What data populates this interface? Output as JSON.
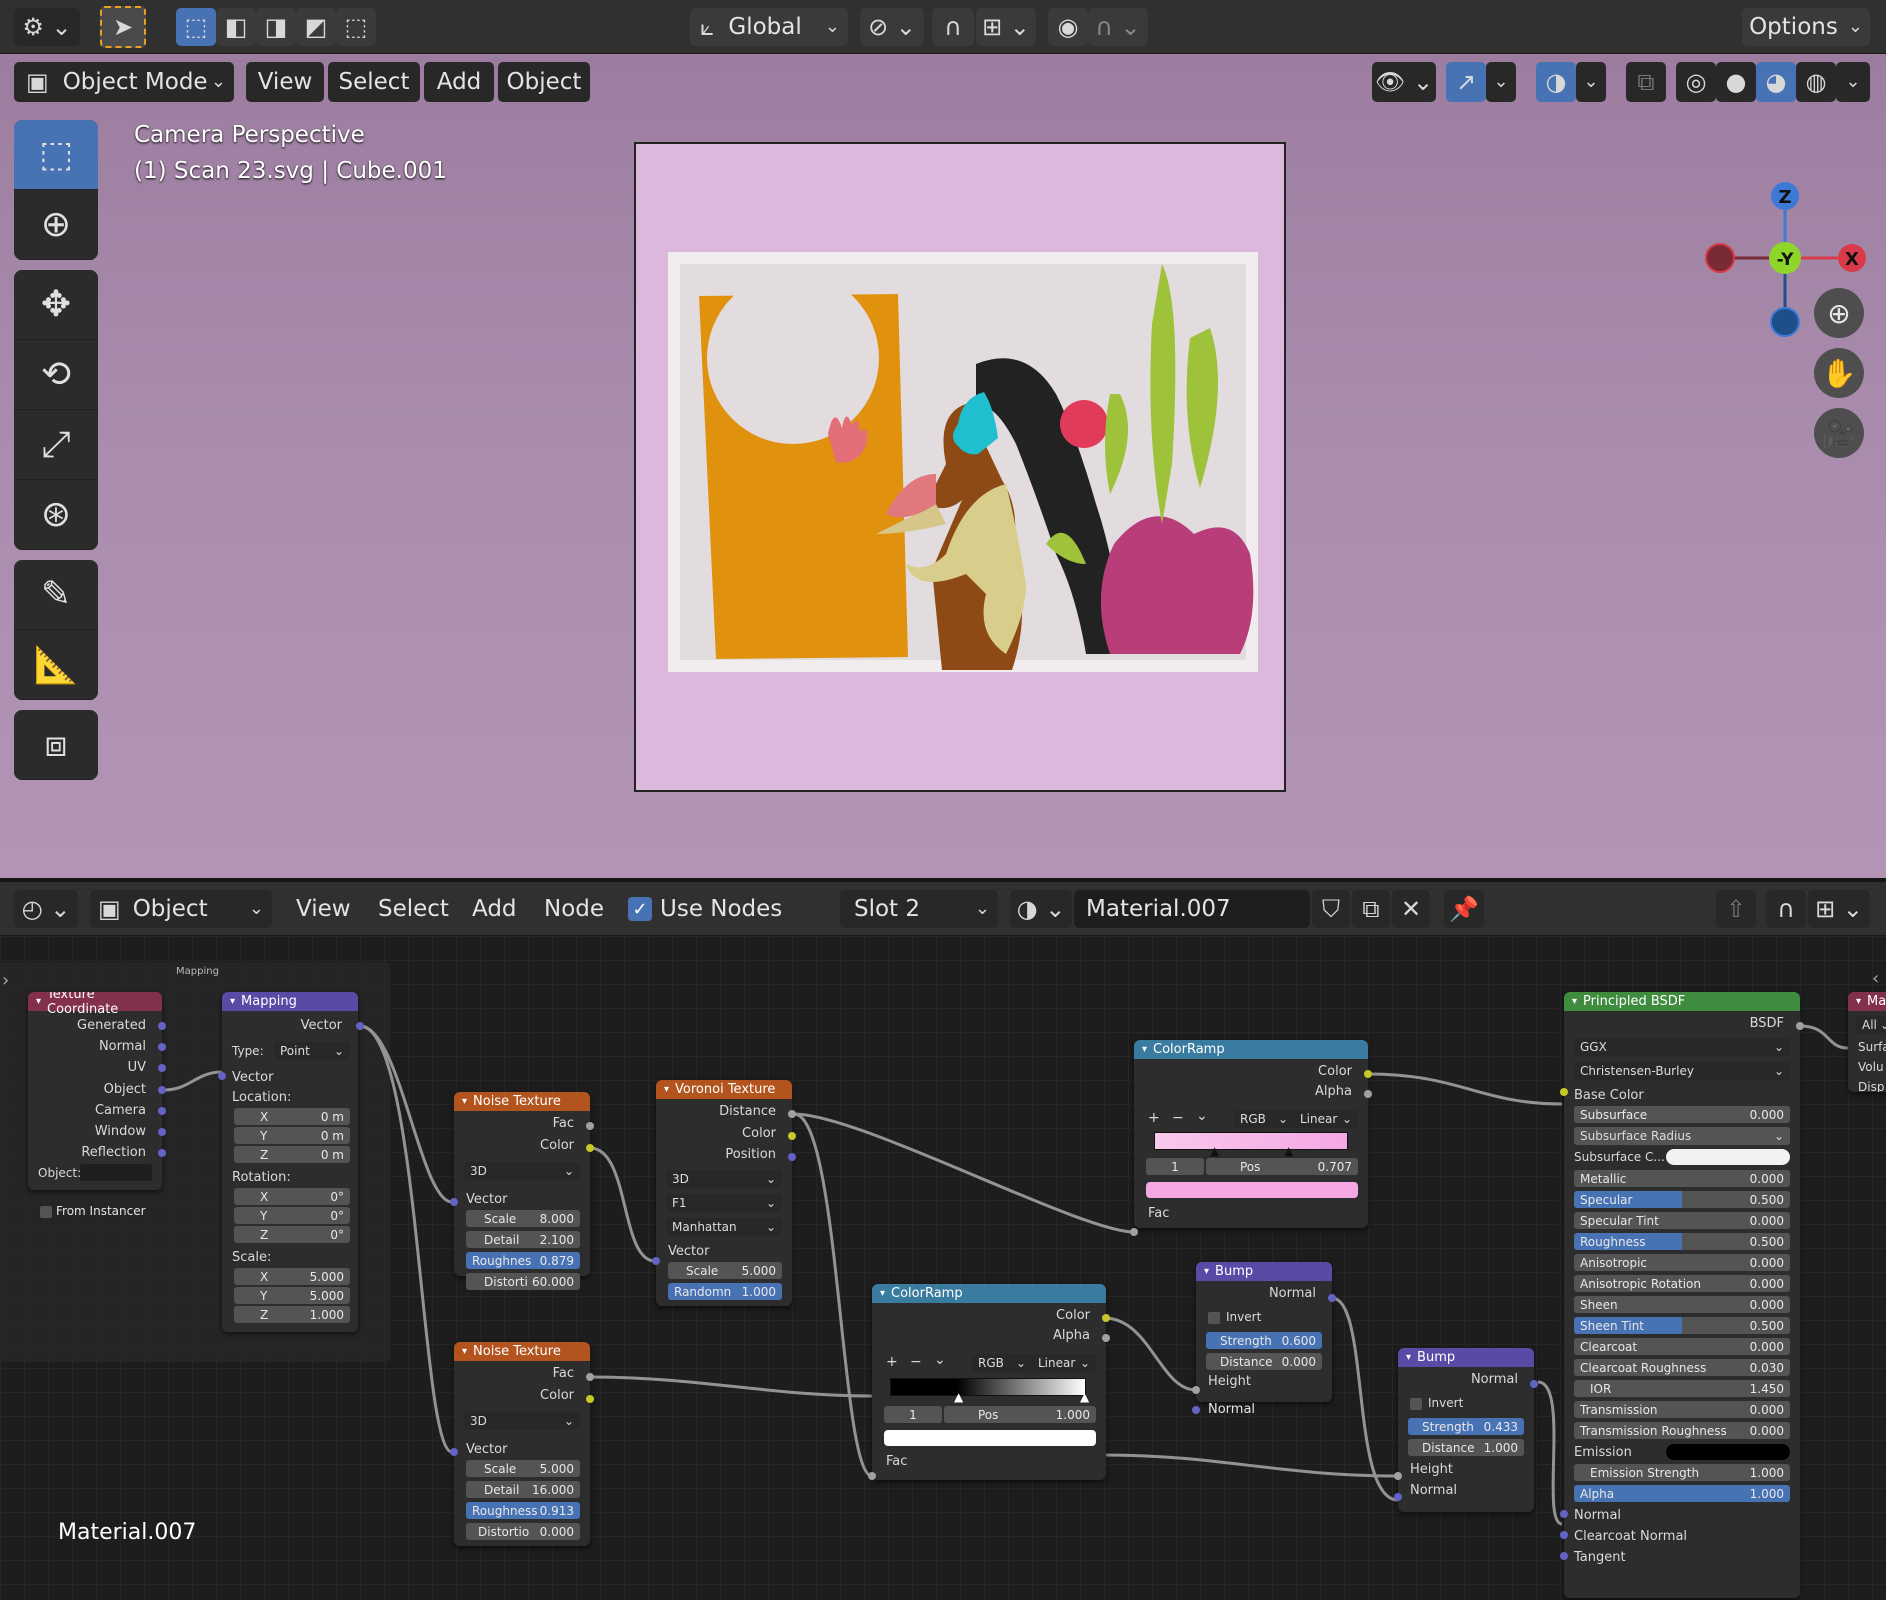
{
  "top_header": {
    "transform_orientation": "Global",
    "options": "Options"
  },
  "viewport_header": {
    "mode": "Object Mode",
    "menus": [
      "View",
      "Select",
      "Add",
      "Object"
    ]
  },
  "viewport": {
    "title": "Camera Perspective",
    "subtitle": "(1) Scan 23.svg | Cube.001",
    "gizmo": {
      "z": "Z",
      "y": "-Y",
      "x": "X"
    }
  },
  "node_header": {
    "editor": "Object",
    "menus": [
      "View",
      "Select",
      "Add",
      "Node"
    ],
    "use_nodes": "Use Nodes",
    "slot": "Slot 2",
    "material": "Material.007"
  },
  "frame_label": "Mapping",
  "corner_label": "Material.007",
  "nodes": {
    "texcoord": {
      "title": "Texture Coordinate",
      "outputs": [
        "Generated",
        "Normal",
        "UV",
        "Object",
        "Camera",
        "Window",
        "Reflection"
      ],
      "object_label": "Object:",
      "from_instancer": "From Instancer"
    },
    "mapping": {
      "title": "Mapping",
      "output": "Vector",
      "type_label": "Type:",
      "type": "Point",
      "vector": "Vector",
      "location": "Location:",
      "loc": [
        [
          "X",
          "0 m"
        ],
        [
          "Y",
          "0 m"
        ],
        [
          "Z",
          "0 m"
        ]
      ],
      "rotation": "Rotation:",
      "rot": [
        [
          "X",
          "0°"
        ],
        [
          "Y",
          "0°"
        ],
        [
          "Z",
          "0°"
        ]
      ],
      "scale": "Scale:",
      "scl": [
        [
          "X",
          "5.000"
        ],
        [
          "Y",
          "5.000"
        ],
        [
          "Z",
          "1.000"
        ]
      ]
    },
    "noise1": {
      "title": "Noise Texture",
      "fac": "Fac",
      "color": "Color",
      "dim": "3D",
      "vector": "Vector",
      "fields": [
        [
          "Scale",
          "8.000"
        ],
        [
          "Detail",
          "2.100"
        ],
        [
          "Roughnes",
          "0.879"
        ],
        [
          "Distorti",
          "60.000"
        ]
      ]
    },
    "noise2": {
      "title": "Noise Texture",
      "fac": "Fac",
      "color": "Color",
      "dim": "3D",
      "vector": "Vector",
      "fields": [
        [
          "Scale",
          "5.000"
        ],
        [
          "Detail",
          "16.000"
        ],
        [
          "Roughness",
          "0.913"
        ],
        [
          "Distortio",
          "0.000"
        ]
      ]
    },
    "voronoi": {
      "title": "Voronoi Texture",
      "outputs": [
        "Distance",
        "Color",
        "Position"
      ],
      "dim": "3D",
      "feature": "F1",
      "metric": "Manhattan",
      "vector": "Vector",
      "fields": [
        [
          "Scale",
          "5.000"
        ],
        [
          "Randomn",
          "1.000"
        ]
      ]
    },
    "ramp1": {
      "title": "ColorRamp",
      "color": "Color",
      "alpha": "Alpha",
      "mode": "RGB",
      "interp": "Linear",
      "index": "1",
      "pos_label": "Pos",
      "pos": "0.707",
      "fac": "Fac"
    },
    "ramp2": {
      "title": "ColorRamp",
      "color": "Color",
      "alpha": "Alpha",
      "mode": "RGB",
      "interp": "Linear",
      "index": "1",
      "pos_label": "Pos",
      "pos": "1.000",
      "fac": "Fac"
    },
    "bump1": {
      "title": "Bump",
      "normal_out": "Normal",
      "invert": "Invert",
      "strength": "Strength",
      "strength_v": "0.600",
      "distance": "Distance",
      "distance_v": "0.000",
      "height": "Height",
      "normal": "Normal"
    },
    "bump2": {
      "title": "Bump",
      "normal_out": "Normal",
      "invert": "Invert",
      "strength": "Strength",
      "strength_v": "0.433",
      "distance": "Distance",
      "distance_v": "1.000",
      "height": "Height",
      "normal": "Normal"
    },
    "bsdf": {
      "title": "Principled BSDF",
      "output": "BSDF",
      "dist": "GGX",
      "sss": "Christensen-Burley",
      "base_color": "Base Color",
      "fields": [
        [
          "Subsurface",
          "0.000"
        ],
        [
          "Subsurface Radius",
          ""
        ],
        [
          "Subsurface C...",
          ""
        ],
        [
          "Metallic",
          "0.000"
        ],
        [
          "Specular",
          "0.500"
        ],
        [
          "Specular Tint",
          "0.000"
        ],
        [
          "Roughness",
          "0.500"
        ],
        [
          "Anisotropic",
          "0.000"
        ],
        [
          "Anisotropic Rotation",
          "0.000"
        ],
        [
          "Sheen",
          "0.000"
        ],
        [
          "Sheen Tint",
          "0.500"
        ],
        [
          "Clearcoat",
          "0.000"
        ],
        [
          "Clearcoat Roughness",
          "0.030"
        ],
        [
          "IOR",
          "1.450"
        ],
        [
          "Transmission",
          "0.000"
        ],
        [
          "Transmission Roughness",
          "0.000"
        ],
        [
          "Emission",
          ""
        ],
        [
          "Emission Strength",
          "1.000"
        ],
        [
          "Alpha",
          "1.000"
        ]
      ],
      "tail": [
        "Normal",
        "Clearcoat Normal",
        "Tangent"
      ]
    },
    "output": {
      "title": "Ma",
      "target": "All",
      "inputs": [
        "Surfa",
        "Volu",
        "Disp"
      ]
    }
  }
}
